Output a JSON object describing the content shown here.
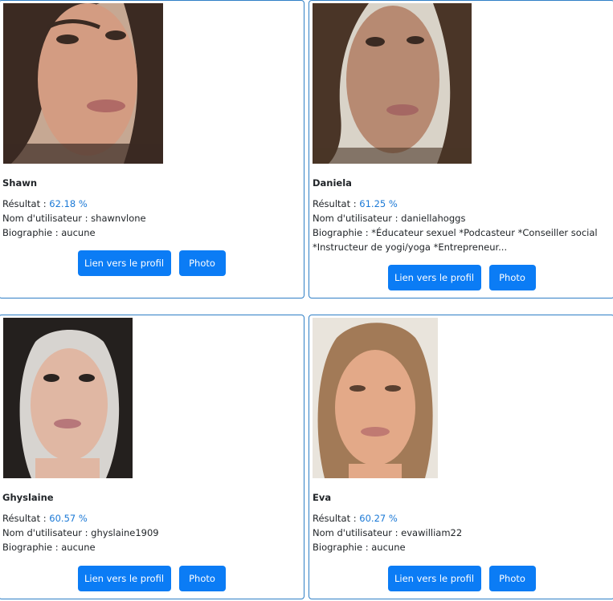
{
  "labels": {
    "score": "Résultat : ",
    "username": "Nom d'utilisateur : ",
    "bio": "Biographie : ",
    "profile_button": "Lien vers le profil",
    "photo_button": "Photo"
  },
  "profiles": [
    {
      "name": "Shawn",
      "score": "62.18 %",
      "username": "shawnvlone",
      "bio": "aucune",
      "colors": {
        "background": "#c6a893",
        "hair": "#3b2a22",
        "skin": "#d39c82",
        "lips": "#b06a66"
      }
    },
    {
      "name": "Daniela",
      "score": "61.25 %",
      "username": "daniellahoggs",
      "bio": "*Éducateur sexuel *Podcasteur *Conseiller social *Instructeur de yogi/yoga *Entrepreneur...",
      "colors": {
        "background": "#d9d3c8",
        "hair": "#4a3527",
        "skin": "#b78a72",
        "lips": "#a56763"
      }
    },
    {
      "name": "Ghyslaine",
      "score": "60.57 %",
      "username": "ghyslaine1909",
      "bio": "aucune",
      "colors": {
        "background": "#d7d4d0",
        "hair": "#24201e",
        "skin": "#e0b7a3",
        "lips": "#b7777a"
      }
    },
    {
      "name": "Eva",
      "score": "60.27 %",
      "username": "evawilliam22",
      "bio": "aucune",
      "colors": {
        "background": "#e9e4dc",
        "hair": "#a27a57",
        "skin": "#e3a988",
        "lips": "#c07a72"
      }
    }
  ]
}
